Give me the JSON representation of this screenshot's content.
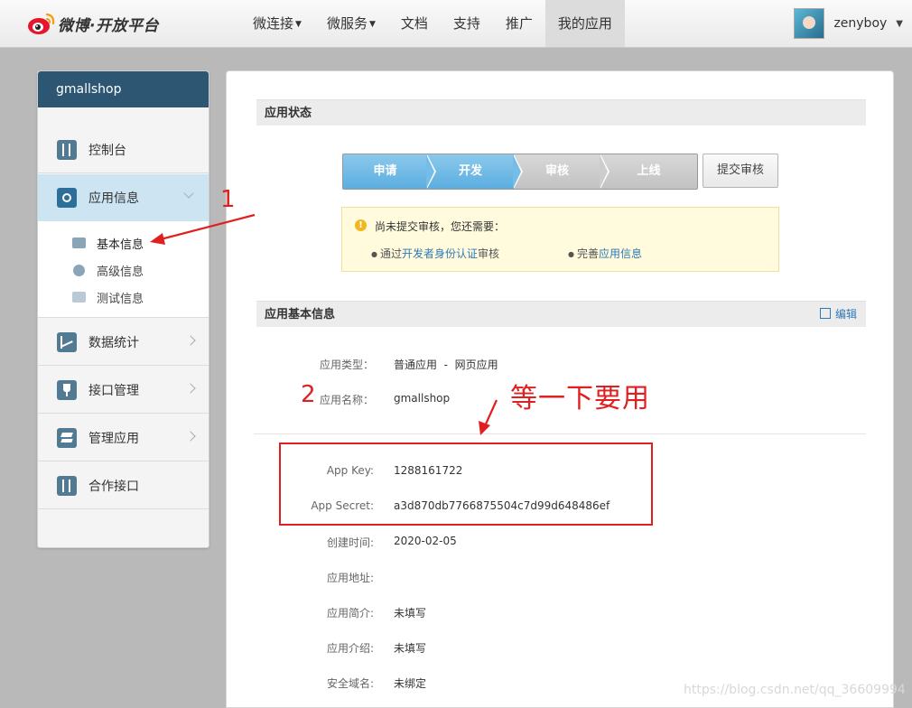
{
  "brand": {
    "logo_text": "微博·开放平台",
    "logo_color": "#e6162d"
  },
  "nav": {
    "items": [
      {
        "label": "微连接",
        "has_caret": true
      },
      {
        "label": "微服务",
        "has_caret": true
      },
      {
        "label": "文档"
      },
      {
        "label": "支持"
      },
      {
        "label": "推广"
      },
      {
        "label": "我的应用",
        "active": true
      }
    ]
  },
  "user": {
    "name": "zenyboy"
  },
  "sidebar": {
    "app_name": "gmallshop",
    "items": [
      {
        "label": "控制台",
        "icon": "console-icon"
      },
      {
        "label": "应用信息",
        "icon": "gear-icon",
        "active": true,
        "expanded": true
      },
      {
        "label": "数据统计",
        "icon": "chart-icon"
      },
      {
        "label": "接口管理",
        "icon": "plug-icon"
      },
      {
        "label": "管理应用",
        "icon": "layers-icon"
      },
      {
        "label": "合作接口",
        "icon": "console-icon"
      }
    ],
    "sub_items": [
      {
        "label": "基本信息",
        "icon": "card-icon",
        "active": true
      },
      {
        "label": "高级信息",
        "icon": "info-icon"
      },
      {
        "label": "测试信息",
        "icon": "image-icon"
      }
    ]
  },
  "status": {
    "title": "应用状态",
    "steps": [
      "申请",
      "开发",
      "审核",
      "上线"
    ],
    "current_step": 2,
    "submit_label": "提交审核",
    "notice": {
      "title": "尚未提交审核，您还需要：",
      "items": [
        {
          "prefix": "通过",
          "link": "开发者身份认证",
          "suffix": "审核"
        },
        {
          "prefix": "完善",
          "link": "应用信息",
          "suffix": ""
        }
      ]
    }
  },
  "basic": {
    "title": "应用基本信息",
    "edit_label": "编辑",
    "fields": [
      {
        "label": "应用类型：",
        "value": "普通应用  -  网页应用"
      },
      {
        "label": "应用名称：",
        "value": "gmallshop"
      },
      {
        "label": "App Key:",
        "value": "1288161722"
      },
      {
        "label": "App Secret:",
        "value": "a3d870db7766875504c7d99d648486ef"
      },
      {
        "label": "创建时间:",
        "value": "2020-02-05"
      },
      {
        "label": "应用地址:",
        "value": ""
      },
      {
        "label": "应用简介:",
        "value": "未填写"
      },
      {
        "label": "应用介绍:",
        "value": "未填写"
      },
      {
        "label": "安全域名:",
        "value": "未绑定"
      }
    ]
  },
  "annotations": {
    "marker1": "1",
    "marker2": "2",
    "note": "等一下要用",
    "color": "#e02020"
  },
  "watermark": "https://blog.csdn.net/qq_36609994"
}
